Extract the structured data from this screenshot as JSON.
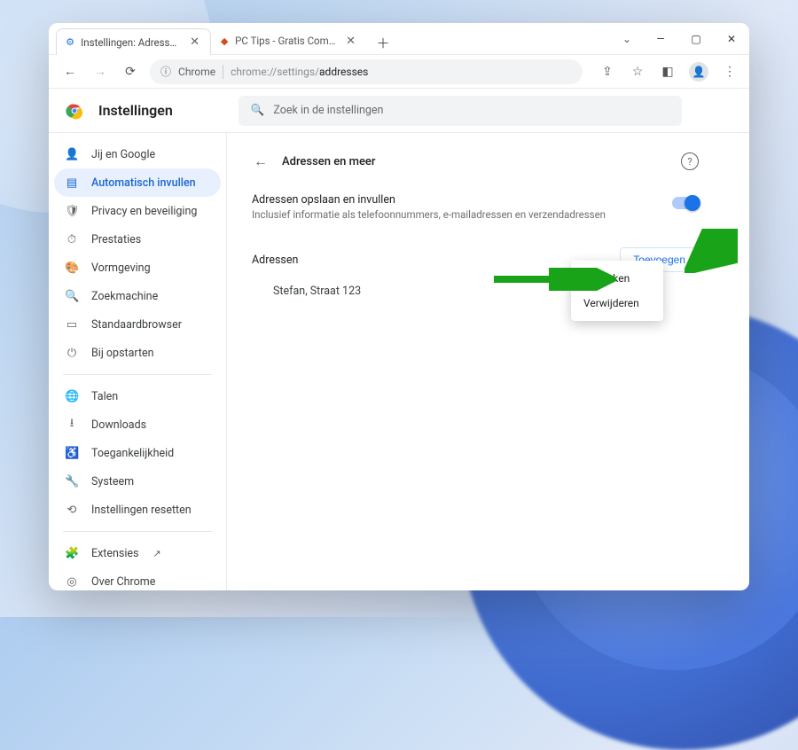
{
  "tabs": {
    "active": {
      "title": "Instellingen: Adressen en meer"
    },
    "inactive": {
      "title": "PC Tips - Gratis Computer Tips."
    }
  },
  "omnibox": {
    "scheme_label": "Chrome",
    "domain": "chrome://settings/",
    "path": "addresses"
  },
  "settings": {
    "app_title": "Instellingen",
    "search_placeholder": "Zoek in de instellingen"
  },
  "sidebar": {
    "group1": [
      {
        "label": "Jij en Google"
      },
      {
        "label": "Automatisch invullen"
      },
      {
        "label": "Privacy en beveiliging"
      },
      {
        "label": "Prestaties"
      },
      {
        "label": "Vormgeving"
      },
      {
        "label": "Zoekmachine"
      },
      {
        "label": "Standaardbrowser"
      },
      {
        "label": "Bij opstarten"
      }
    ],
    "group2": [
      {
        "label": "Talen"
      },
      {
        "label": "Downloads"
      },
      {
        "label": "Toegankelijkheid"
      },
      {
        "label": "Systeem"
      },
      {
        "label": "Instellingen resetten"
      }
    ],
    "group3": [
      {
        "label": "Extensies"
      },
      {
        "label": "Over Chrome"
      }
    ]
  },
  "page": {
    "title": "Adressen en meer",
    "toggle_title": "Adressen opslaan en invullen",
    "toggle_sub": "Inclusief informatie als telefoonnummers, e-mailadressen en verzendadressen",
    "section_title": "Adressen",
    "add_button": "Toevoegen",
    "address_entry": "Stefan, Straat 123"
  },
  "menu": {
    "edit": "Bewerken",
    "delete": "Verwijderen"
  }
}
